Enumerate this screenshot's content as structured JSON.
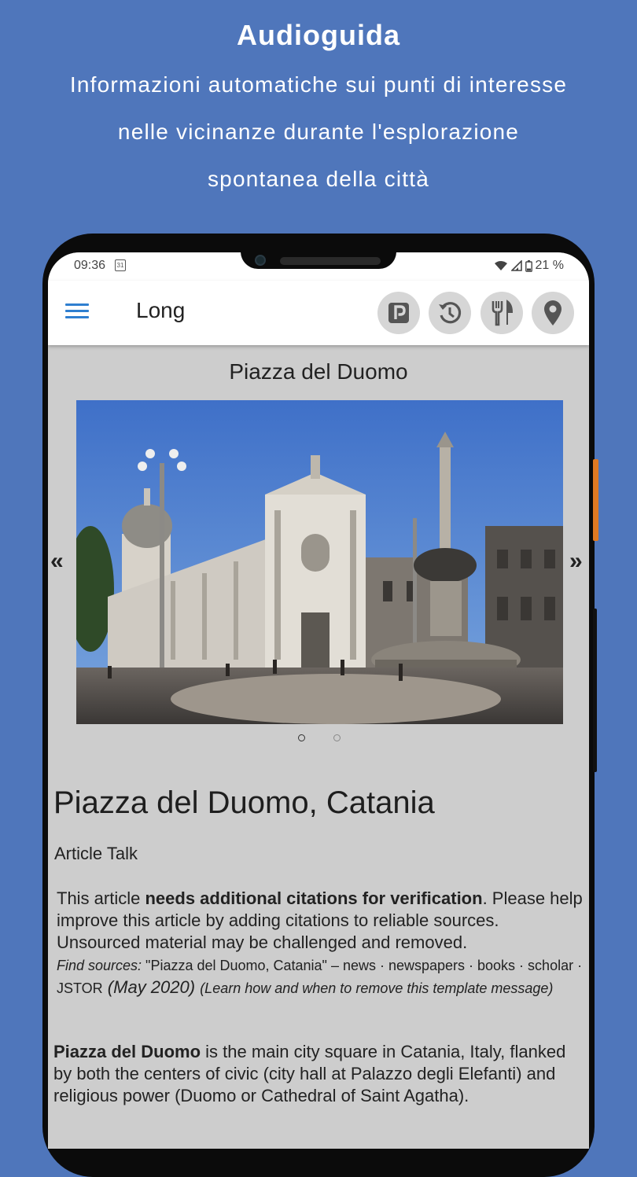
{
  "promo": {
    "title": "Audioguida",
    "lines": [
      "Informazioni automatiche sui punti di interesse",
      "nelle vicinanze durante l'esplorazione",
      "spontanea della città"
    ]
  },
  "status_bar": {
    "time": "09:36",
    "calendar_day": "31",
    "battery": "21 %",
    "icons": [
      "calendar-icon",
      "wifi-icon",
      "signal-icon",
      "battery-icon"
    ]
  },
  "app_bar": {
    "title": "Long",
    "actions": [
      "parking-icon",
      "history-icon",
      "restaurant-icon",
      "location-pin-icon"
    ]
  },
  "carousel": {
    "place_title": "Piazza del Duomo",
    "prev_label": "«",
    "next_label": "»",
    "page_count": 2,
    "active_page": 1
  },
  "article": {
    "title": "Piazza del Duomo, Catania",
    "tabs": "Article Talk",
    "notice": {
      "lead": "This article ",
      "bold": "needs additional citations for verification",
      "rest": ". Please help improve this article by adding citations to reliable sources. Unsourced material may be challenged and removed.",
      "find_sources_label": "Find sources:",
      "find_sources_text": " \"Piazza del Duomo, Catania\" – news · newspapers · books · scholar · JSTOR",
      "date": " (May 2020) ",
      "learn_more": "(Learn how and when to remove this template message)"
    },
    "paragraph": {
      "bold": "Piazza del Duomo",
      "text": " is the main city square in Catania, Italy, flanked by both the centers of civic (city hall at Palazzo degli Elefanti) and religious power (Duomo or Cathedral of Saint Agatha)."
    }
  }
}
